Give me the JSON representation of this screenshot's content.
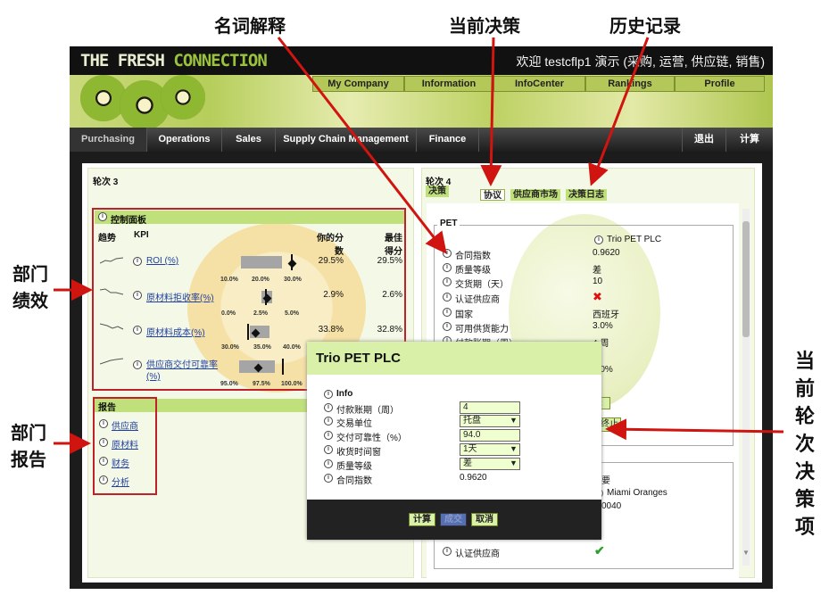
{
  "annotations": {
    "term": "名词解释",
    "current_decision": "当前决策",
    "history": "历史记录",
    "dept_perf_1": "部门",
    "dept_perf_2": "绩效",
    "dept_report_1": "部门",
    "dept_report_2": "报告",
    "current_items": [
      "当",
      "前",
      "轮",
      "次",
      "决",
      "策",
      "项"
    ]
  },
  "app": {
    "logo_a": "THE FRESH ",
    "logo_b": "CONNECTION",
    "welcome": "欢迎   testcflp1 演示 (采购, 运营, 供应链, 销售)"
  },
  "top_tabs": [
    "My Company",
    "Information",
    "InfoCenter",
    "Rankings",
    "Profile"
  ],
  "nav": {
    "items": [
      "Purchasing",
      "Operations",
      "Sales",
      "Supply Chain Management",
      "Finance"
    ],
    "logout": "退出",
    "calc": "计算"
  },
  "left": {
    "round": "轮次 3",
    "dashboard_title": "控制面板",
    "col_trend": "趋势",
    "col_kpi": "KPI",
    "col_your_1": "你的分",
    "col_your_2": "数",
    "col_best_1": "最佳",
    "col_best_2": "得分",
    "kpis": [
      {
        "name": "ROI (%)",
        "your": "29.5%",
        "best": "29.5%",
        "ticks": [
          "10.0%",
          "20.0%",
          "30.0%"
        ]
      },
      {
        "name": "原材料拒收率(%)",
        "your": "2.9%",
        "best": "2.6%",
        "ticks": [
          "0.0%",
          "2.5%",
          "5.0%"
        ]
      },
      {
        "name": "原材料成本(%)",
        "your": "33.8%",
        "best": "32.8%",
        "ticks": [
          "30.0%",
          "35.0%",
          "40.0%"
        ]
      },
      {
        "name_1": "供应商交付可靠率",
        "name_2": "(%)",
        "ticks": [
          "95.0%",
          "97.5%",
          "100.0%"
        ]
      }
    ],
    "report_title": "报告",
    "reports": [
      "供应商",
      "原材料",
      "财务",
      "分析"
    ]
  },
  "right": {
    "round": "轮次 4",
    "decision": "决策",
    "tabs": [
      "协议",
      "供应商市场",
      "决策日志"
    ],
    "pet_label": "PET",
    "supplier": "Trio PET PLC",
    "rows": [
      {
        "label": "合同指数",
        "value": "0.9620"
      },
      {
        "label": "质量等级",
        "value": "差"
      },
      {
        "label": "交货期（天）",
        "value": "10"
      },
      {
        "label": "认证供应商",
        "value": "✖"
      },
      {
        "label": "国家",
        "value": "西班牙"
      },
      {
        "label": "可用供货能力",
        "value": "3.0%"
      },
      {
        "label": "付款账期（周）",
        "value": "4 周"
      }
    ],
    "partial_values": [
      "盘",
      "0.0%",
      "天",
      "是"
    ],
    "partial_btn": "终止",
    "lower_label": "要",
    "lower_supplier": "Miami Oranges",
    "lower_value": "0040",
    "lower_cert": "认证供应商",
    "lower_cert_value": "✔"
  },
  "modal": {
    "title": "Trio PET PLC",
    "info": "Info",
    "fields": [
      {
        "label": "付款账期（周）",
        "value": "4"
      },
      {
        "label": "交易单位",
        "value": "托盘"
      },
      {
        "label": "交付可靠性（%）",
        "value": "94.0"
      },
      {
        "label": "收货时间窗",
        "value": "1天"
      },
      {
        "label": "质量等级",
        "value": "差"
      }
    ],
    "contract_label": "合同指数",
    "contract_value": "0.9620",
    "buttons": [
      "计算",
      "成交",
      "取消"
    ]
  }
}
